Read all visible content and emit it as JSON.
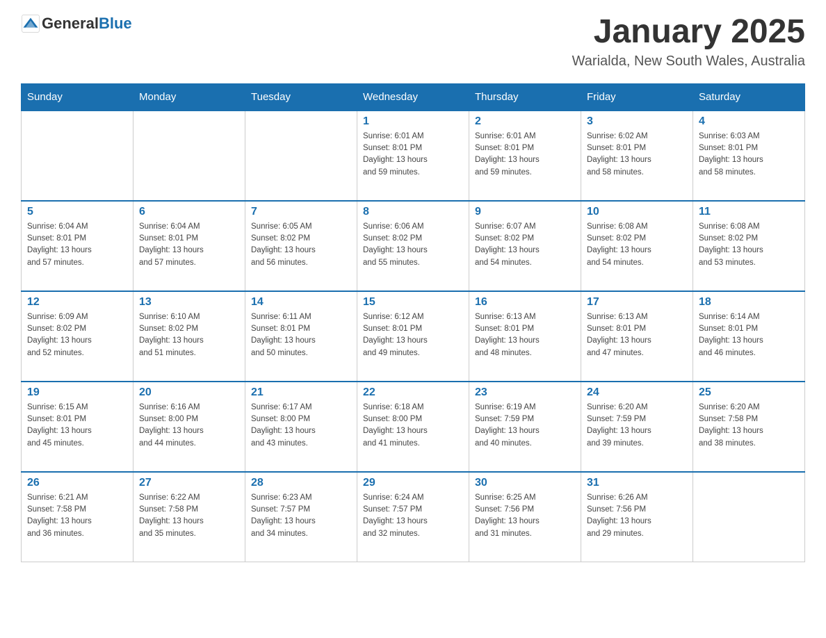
{
  "header": {
    "logo_general": "General",
    "logo_blue": "Blue",
    "main_title": "January 2025",
    "subtitle": "Warialda, New South Wales, Australia"
  },
  "days_of_week": [
    "Sunday",
    "Monday",
    "Tuesday",
    "Wednesday",
    "Thursday",
    "Friday",
    "Saturday"
  ],
  "weeks": [
    [
      {
        "day": "",
        "info": ""
      },
      {
        "day": "",
        "info": ""
      },
      {
        "day": "",
        "info": ""
      },
      {
        "day": "1",
        "info": "Sunrise: 6:01 AM\nSunset: 8:01 PM\nDaylight: 13 hours\nand 59 minutes."
      },
      {
        "day": "2",
        "info": "Sunrise: 6:01 AM\nSunset: 8:01 PM\nDaylight: 13 hours\nand 59 minutes."
      },
      {
        "day": "3",
        "info": "Sunrise: 6:02 AM\nSunset: 8:01 PM\nDaylight: 13 hours\nand 58 minutes."
      },
      {
        "day": "4",
        "info": "Sunrise: 6:03 AM\nSunset: 8:01 PM\nDaylight: 13 hours\nand 58 minutes."
      }
    ],
    [
      {
        "day": "5",
        "info": "Sunrise: 6:04 AM\nSunset: 8:01 PM\nDaylight: 13 hours\nand 57 minutes."
      },
      {
        "day": "6",
        "info": "Sunrise: 6:04 AM\nSunset: 8:01 PM\nDaylight: 13 hours\nand 57 minutes."
      },
      {
        "day": "7",
        "info": "Sunrise: 6:05 AM\nSunset: 8:02 PM\nDaylight: 13 hours\nand 56 minutes."
      },
      {
        "day": "8",
        "info": "Sunrise: 6:06 AM\nSunset: 8:02 PM\nDaylight: 13 hours\nand 55 minutes."
      },
      {
        "day": "9",
        "info": "Sunrise: 6:07 AM\nSunset: 8:02 PM\nDaylight: 13 hours\nand 54 minutes."
      },
      {
        "day": "10",
        "info": "Sunrise: 6:08 AM\nSunset: 8:02 PM\nDaylight: 13 hours\nand 54 minutes."
      },
      {
        "day": "11",
        "info": "Sunrise: 6:08 AM\nSunset: 8:02 PM\nDaylight: 13 hours\nand 53 minutes."
      }
    ],
    [
      {
        "day": "12",
        "info": "Sunrise: 6:09 AM\nSunset: 8:02 PM\nDaylight: 13 hours\nand 52 minutes."
      },
      {
        "day": "13",
        "info": "Sunrise: 6:10 AM\nSunset: 8:02 PM\nDaylight: 13 hours\nand 51 minutes."
      },
      {
        "day": "14",
        "info": "Sunrise: 6:11 AM\nSunset: 8:01 PM\nDaylight: 13 hours\nand 50 minutes."
      },
      {
        "day": "15",
        "info": "Sunrise: 6:12 AM\nSunset: 8:01 PM\nDaylight: 13 hours\nand 49 minutes."
      },
      {
        "day": "16",
        "info": "Sunrise: 6:13 AM\nSunset: 8:01 PM\nDaylight: 13 hours\nand 48 minutes."
      },
      {
        "day": "17",
        "info": "Sunrise: 6:13 AM\nSunset: 8:01 PM\nDaylight: 13 hours\nand 47 minutes."
      },
      {
        "day": "18",
        "info": "Sunrise: 6:14 AM\nSunset: 8:01 PM\nDaylight: 13 hours\nand 46 minutes."
      }
    ],
    [
      {
        "day": "19",
        "info": "Sunrise: 6:15 AM\nSunset: 8:01 PM\nDaylight: 13 hours\nand 45 minutes."
      },
      {
        "day": "20",
        "info": "Sunrise: 6:16 AM\nSunset: 8:00 PM\nDaylight: 13 hours\nand 44 minutes."
      },
      {
        "day": "21",
        "info": "Sunrise: 6:17 AM\nSunset: 8:00 PM\nDaylight: 13 hours\nand 43 minutes."
      },
      {
        "day": "22",
        "info": "Sunrise: 6:18 AM\nSunset: 8:00 PM\nDaylight: 13 hours\nand 41 minutes."
      },
      {
        "day": "23",
        "info": "Sunrise: 6:19 AM\nSunset: 7:59 PM\nDaylight: 13 hours\nand 40 minutes."
      },
      {
        "day": "24",
        "info": "Sunrise: 6:20 AM\nSunset: 7:59 PM\nDaylight: 13 hours\nand 39 minutes."
      },
      {
        "day": "25",
        "info": "Sunrise: 6:20 AM\nSunset: 7:58 PM\nDaylight: 13 hours\nand 38 minutes."
      }
    ],
    [
      {
        "day": "26",
        "info": "Sunrise: 6:21 AM\nSunset: 7:58 PM\nDaylight: 13 hours\nand 36 minutes."
      },
      {
        "day": "27",
        "info": "Sunrise: 6:22 AM\nSunset: 7:58 PM\nDaylight: 13 hours\nand 35 minutes."
      },
      {
        "day": "28",
        "info": "Sunrise: 6:23 AM\nSunset: 7:57 PM\nDaylight: 13 hours\nand 34 minutes."
      },
      {
        "day": "29",
        "info": "Sunrise: 6:24 AM\nSunset: 7:57 PM\nDaylight: 13 hours\nand 32 minutes."
      },
      {
        "day": "30",
        "info": "Sunrise: 6:25 AM\nSunset: 7:56 PM\nDaylight: 13 hours\nand 31 minutes."
      },
      {
        "day": "31",
        "info": "Sunrise: 6:26 AM\nSunset: 7:56 PM\nDaylight: 13 hours\nand 29 minutes."
      },
      {
        "day": "",
        "info": ""
      }
    ]
  ]
}
